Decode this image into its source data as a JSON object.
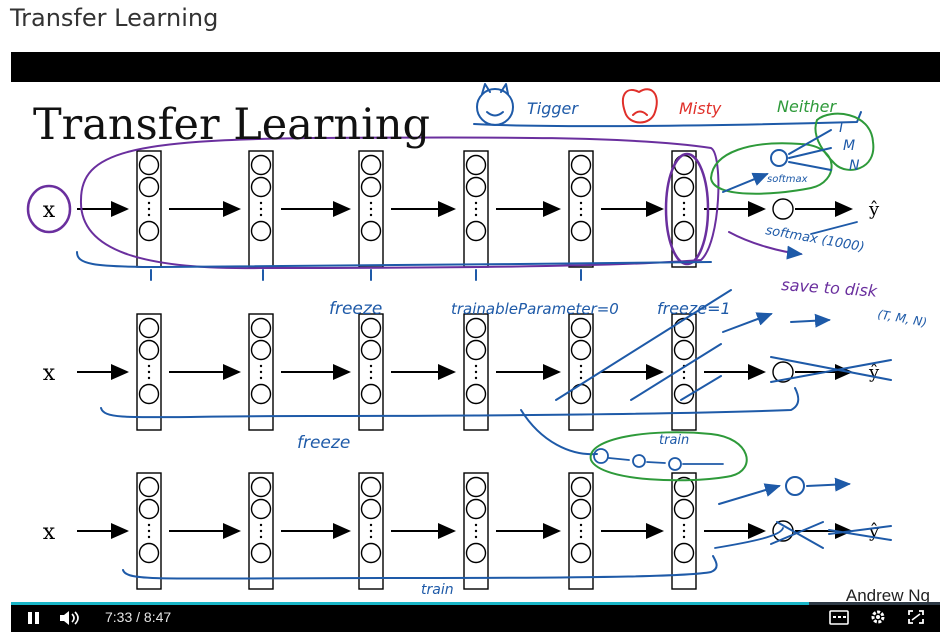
{
  "page": {
    "title": "Transfer Learning"
  },
  "slide": {
    "title": "Transfer Learning",
    "presenter": "Andrew Ng",
    "row_input_label": "x",
    "output_label": "ŷ",
    "annotations": {
      "classes": [
        "Tigger",
        "Misty",
        "Neither"
      ],
      "softmax_outputs": [
        "T",
        "M",
        "N"
      ],
      "softmax": "softmax",
      "softmax_1000": "softmax (1000)",
      "save_to_disk": "save to disk",
      "freeze_row1": "freeze",
      "trainable_param": "trainableParameter=0",
      "freeze_eq": "freeze=1",
      "yhat_classes": "(T, M, N)",
      "train_row2": "train",
      "freeze_row2": "freeze",
      "train_row3": "train"
    },
    "colors": {
      "purple": "#6a2f9e",
      "blue": "#1e5aa8",
      "green": "#2e9a3a",
      "red": "#e0302a"
    }
  },
  "player": {
    "current_time": "7:33",
    "separator": " / ",
    "duration": "8:47",
    "progress_fraction": 0.859
  }
}
